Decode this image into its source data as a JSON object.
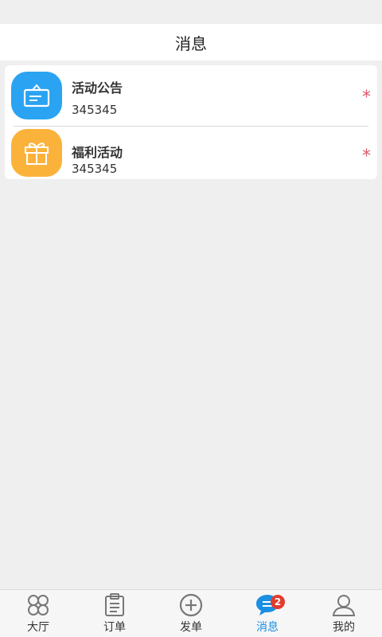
{
  "header": {
    "title": "消息"
  },
  "messages": [
    {
      "title": "活动公告",
      "subtitle": "345345",
      "indicator": "*",
      "icon": "notice-icon",
      "color": "#2aa3f2"
    },
    {
      "title": "福利活动",
      "subtitle": "345345",
      "indicator": "*",
      "icon": "gift-icon",
      "color": "#fbb23a"
    }
  ],
  "tabbar": {
    "active_color": "#1a8fe3",
    "tabs": [
      {
        "label": "大厅",
        "icon": "clover-icon"
      },
      {
        "label": "订单",
        "icon": "clipboard-icon"
      },
      {
        "label": "发单",
        "icon": "plus-circle-icon"
      },
      {
        "label": "消息",
        "icon": "chat-bubble-icon",
        "badge": "2",
        "active": true
      },
      {
        "label": "我的",
        "icon": "user-icon"
      }
    ]
  }
}
